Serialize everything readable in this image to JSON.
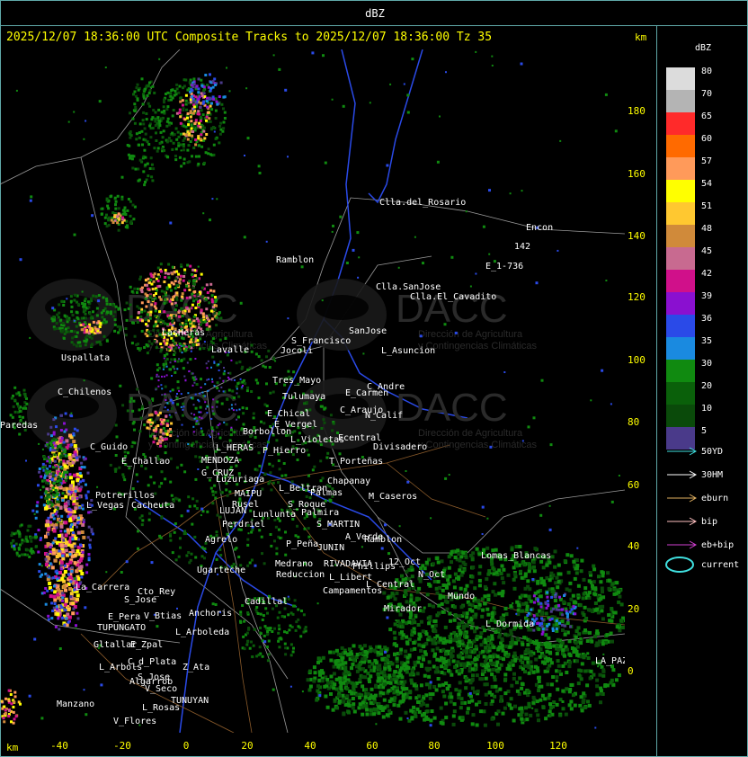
{
  "header": {
    "unit": "dBZ"
  },
  "title": "2025/12/07 18:36:00 UTC Composite Tracks to 2025/12/07 18:36:00 Tz 35",
  "axis": {
    "unit_top": "km",
    "unit_bottom": "km",
    "y_ticks": [
      "180",
      "160",
      "140",
      "120",
      "100",
      "80",
      "60",
      "40",
      "20",
      "0"
    ],
    "x_ticks": [
      "-40",
      "-20",
      "0",
      "20",
      "40",
      "60",
      "80",
      "100",
      "120"
    ]
  },
  "legend": {
    "title": "dBZ",
    "levels": [
      {
        "label": "80",
        "color": "#dcdcdc"
      },
      {
        "label": "70",
        "color": "#b4b4b4"
      },
      {
        "label": "65",
        "color": "#ff2a2a"
      },
      {
        "label": "60",
        "color": "#ff6a00"
      },
      {
        "label": "57",
        "color": "#ff9a5a"
      },
      {
        "label": "54",
        "color": "#ffff00"
      },
      {
        "label": "51",
        "color": "#ffc830"
      },
      {
        "label": "48",
        "color": "#d08a3a"
      },
      {
        "label": "45",
        "color": "#c86a90"
      },
      {
        "label": "42",
        "color": "#d0108a"
      },
      {
        "label": "39",
        "color": "#8a10d0"
      },
      {
        "label": "36",
        "color": "#2a4ae8"
      },
      {
        "label": "35",
        "color": "#1a8ae0"
      },
      {
        "label": "30",
        "color": "#108a10"
      },
      {
        "label": "20",
        "color": "#0a600a"
      },
      {
        "label": "10",
        "color": "#0a4a0a"
      },
      {
        "label": "5",
        "color": "#4a3a8a"
      }
    ],
    "tracks": [
      {
        "label": "50YD",
        "color": "#40e0e0"
      },
      {
        "label": "30HM",
        "color": "#ffffff"
      },
      {
        "label": "eburn",
        "color": "#e0b060"
      },
      {
        "label": "bip",
        "color": "#ffc0c0"
      },
      {
        "label": "eb+bip",
        "color": "#d040d0"
      }
    ],
    "current_label": "current",
    "current_color": "#40e0e0"
  },
  "watermark": {
    "brand": "DACC",
    "line1": "Dirección de Agricultura",
    "line2": "y Contingencias Climáticas"
  },
  "places": [
    {
      "name": "Clla.del_Rosario"
    },
    {
      "name": "Encon"
    },
    {
      "name": "142"
    },
    {
      "name": "E_1-736"
    },
    {
      "name": "Ramblon"
    },
    {
      "name": "Clla.SanJose"
    },
    {
      "name": "Clla.El_Cavadito"
    },
    {
      "name": "SanJose"
    },
    {
      "name": "S_Francisco"
    },
    {
      "name": "L_Asuncion"
    },
    {
      "name": "Jocoli"
    },
    {
      "name": "Uspallata"
    },
    {
      "name": "LasHeras"
    },
    {
      "name": "Lavalle"
    },
    {
      "name": "Tres_Mayo"
    },
    {
      "name": "C_Andre"
    },
    {
      "name": "Tulumaya"
    },
    {
      "name": "E_Carmen"
    },
    {
      "name": "C_Chilenos"
    },
    {
      "name": "E_Chical"
    },
    {
      "name": "C_Araujo"
    },
    {
      "name": "N_Calif"
    },
    {
      "name": "E_Vergel"
    },
    {
      "name": "Paredas"
    },
    {
      "name": "Borbollon"
    },
    {
      "name": "Ecentral"
    },
    {
      "name": "L_Violetas"
    },
    {
      "name": "Divisadero"
    },
    {
      "name": "P_Hierro"
    },
    {
      "name": "C_Guido"
    },
    {
      "name": "L_HERAS"
    },
    {
      "name": "E_Challao"
    },
    {
      "name": "MENDOZA"
    },
    {
      "name": "T_Porteñas"
    },
    {
      "name": "G_CRUZ"
    },
    {
      "name": "Luzuriaga"
    },
    {
      "name": "Chapanay"
    },
    {
      "name": "Potrerillos"
    },
    {
      "name": "L_Beltran"
    },
    {
      "name": "MAIPU"
    },
    {
      "name": "Cacheuta"
    },
    {
      "name": "Rusel"
    },
    {
      "name": "Palmas"
    },
    {
      "name": "M_Caseros"
    },
    {
      "name": "L_Vegas"
    },
    {
      "name": "LUJAN"
    },
    {
      "name": "S_Roque"
    },
    {
      "name": "Lunlunta"
    },
    {
      "name": "Palmira"
    },
    {
      "name": "Perdriel"
    },
    {
      "name": "S_MARTIN"
    },
    {
      "name": "A_Verde"
    },
    {
      "name": "Agrelo"
    },
    {
      "name": "JUNIN"
    },
    {
      "name": "Ramblon"
    },
    {
      "name": "P_Peña"
    },
    {
      "name": "Lomas_Blancas"
    },
    {
      "name": "Ugarteche"
    },
    {
      "name": "Medrano"
    },
    {
      "name": "RIVADAVIA"
    },
    {
      "name": "Phillips"
    },
    {
      "name": "12_Oct"
    },
    {
      "name": "Reduccion"
    },
    {
      "name": "L_Libert"
    },
    {
      "name": "N_Oct"
    },
    {
      "name": "La_Carrera"
    },
    {
      "name": "Cto_Rey"
    },
    {
      "name": "Campamentos"
    },
    {
      "name": "L_Central"
    },
    {
      "name": "Mundo"
    },
    {
      "name": "S_Jose"
    },
    {
      "name": "Cadillal"
    },
    {
      "name": "Mirador"
    },
    {
      "name": "L_Dormida"
    },
    {
      "name": "V_Btias"
    },
    {
      "name": "Anchoris"
    },
    {
      "name": "E_Pera"
    },
    {
      "name": "TUPUNGATO"
    },
    {
      "name": "L_Arboleda"
    },
    {
      "name": "Gltallar"
    },
    {
      "name": "E_Zpal"
    },
    {
      "name": "LA_PAZ"
    },
    {
      "name": "C_d_Plata"
    },
    {
      "name": "L_Arbols"
    },
    {
      "name": "S_Jose"
    },
    {
      "name": "Z_Ata"
    },
    {
      "name": "Algarrob"
    },
    {
      "name": "V_Seco"
    },
    {
      "name": "TUNUYAN"
    },
    {
      "name": "Manzano"
    },
    {
      "name": "L_Rosas"
    },
    {
      "name": "V_Flores"
    }
  ]
}
